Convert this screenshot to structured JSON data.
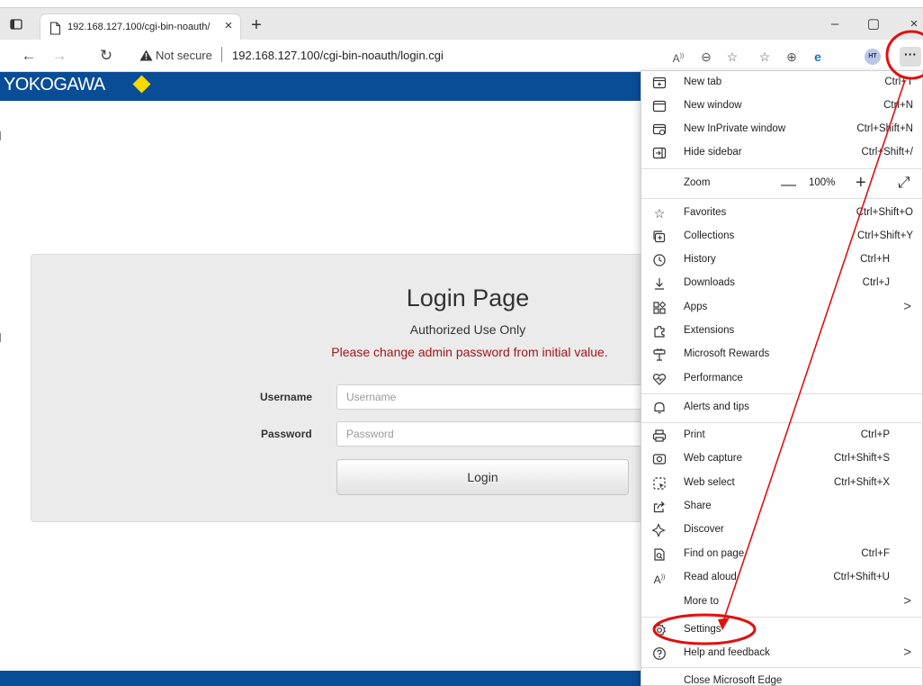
{
  "browser": {
    "tab_title": "192.168.127.100/cgi-bin-noauth/",
    "tab_close": "×",
    "new_tab": "+",
    "window_controls": {
      "minimize": "–",
      "maximize": "▢",
      "close": "×"
    },
    "not_secure": "Not secure",
    "url": "192.168.127.100/cgi-bin-noauth/login.cgi",
    "avatar_initials": "HT",
    "more_label": "···"
  },
  "page": {
    "brand": "YOKOGAWA",
    "title": "Login Page",
    "subtitle": "Authorized Use Only",
    "warning": "Please change admin password from initial value.",
    "username_label": "Username",
    "username_placeholder": "Username",
    "password_label": "Password",
    "password_placeholder": "Password",
    "login_button": "Login",
    "colors": {
      "header": "#0a4d97",
      "warning": "#a1161d",
      "diamond": "#f7d800"
    }
  },
  "menu": {
    "items": [
      {
        "label": "New tab",
        "shortcut": "Ctrl+T",
        "icon": "new-tab-icon"
      },
      {
        "label": "New window",
        "shortcut": "Ctrl+N",
        "icon": "window-icon"
      },
      {
        "label": "New InPrivate window",
        "shortcut": "Ctrl+Shift+N",
        "icon": "inprivate-icon"
      },
      {
        "label": "Hide sidebar",
        "shortcut": "Ctrl+Shift+/",
        "icon": "sidebar-icon"
      },
      {
        "label": "Zoom",
        "zoom_value": "100%",
        "zoom_minus": "—",
        "zoom_plus": "+",
        "icon": ""
      },
      {
        "label": "Favorites",
        "shortcut": "Ctrl+Shift+O",
        "icon": "favorites-icon"
      },
      {
        "label": "Collections",
        "shortcut": "Ctrl+Shift+Y",
        "icon": "collections-icon"
      },
      {
        "label": "History",
        "shortcut": "Ctrl+H",
        "icon": "history-icon"
      },
      {
        "label": "Downloads",
        "shortcut": "Ctrl+J",
        "icon": "download-icon"
      },
      {
        "label": "Apps",
        "chevron": ">",
        "icon": "apps-icon"
      },
      {
        "label": "Extensions",
        "icon": "extensions-icon"
      },
      {
        "label": "Microsoft Rewards",
        "icon": "rewards-icon"
      },
      {
        "label": "Performance",
        "icon": "performance-icon"
      },
      {
        "label": "Alerts and tips",
        "icon": "bell-icon"
      },
      {
        "label": "Print",
        "shortcut": "Ctrl+P",
        "icon": "print-icon"
      },
      {
        "label": "Web capture",
        "shortcut": "Ctrl+Shift+S",
        "icon": "web-capture-icon"
      },
      {
        "label": "Web select",
        "shortcut": "Ctrl+Shift+X",
        "icon": "web-select-icon"
      },
      {
        "label": "Share",
        "icon": "share-icon"
      },
      {
        "label": "Discover",
        "icon": "discover-icon"
      },
      {
        "label": "Find on page",
        "shortcut": "Ctrl+F",
        "icon": "find-icon"
      },
      {
        "label": "Read aloud",
        "shortcut": "Ctrl+Shift+U",
        "icon": "read-aloud-icon"
      },
      {
        "label": "More to",
        "chevron": ">",
        "icon": ""
      },
      {
        "label": "Settings",
        "icon": "gear-icon"
      },
      {
        "label": "Help and feedback",
        "chevron": ">",
        "icon": "help-icon"
      },
      {
        "label": "Close Microsoft Edge",
        "icon": ""
      }
    ]
  },
  "annotations": {
    "color": "#e01010"
  }
}
